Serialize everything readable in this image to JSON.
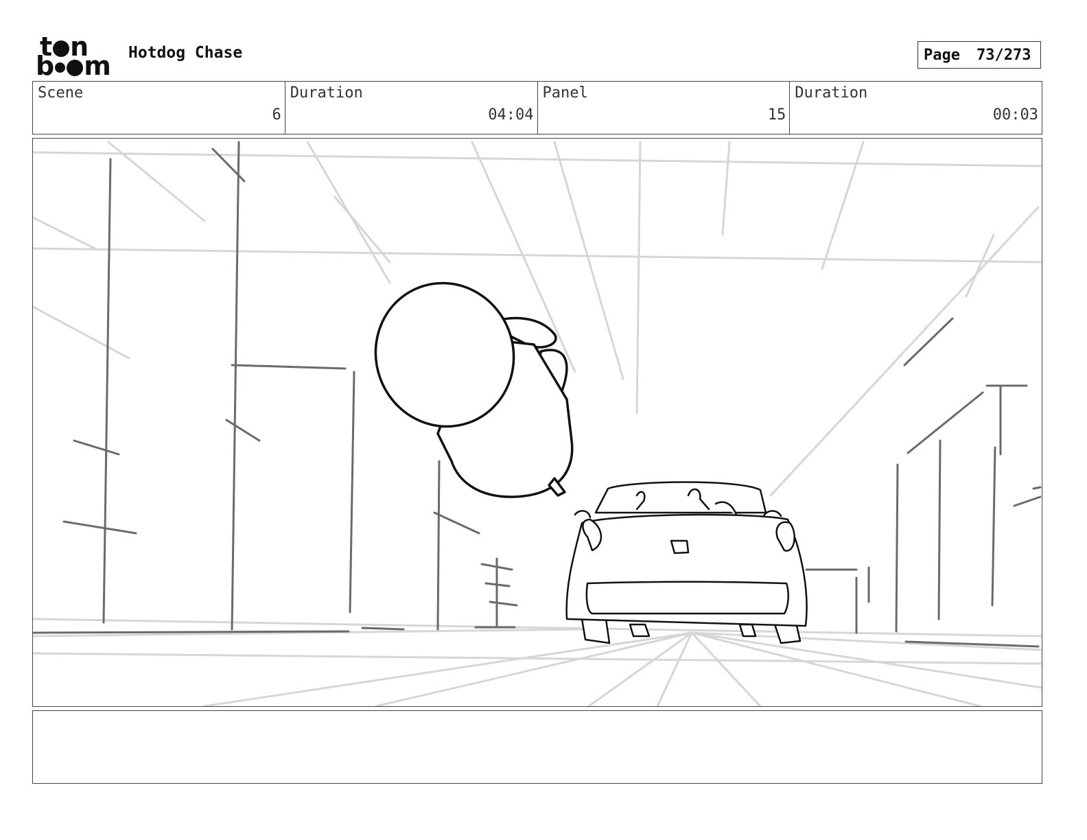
{
  "header": {
    "logo": {
      "line1": "t n",
      "line2": "b m",
      "alt": "toon boom"
    },
    "project_title": "Hotdog Chase",
    "page_label": "Page",
    "page_value": "73/273"
  },
  "info": {
    "scene_label": "Scene",
    "scene_value": "6",
    "scene_duration_label": "Duration",
    "scene_duration_value": "04:04",
    "panel_label": "Panel",
    "panel_value": "15",
    "panel_duration_label": "Duration",
    "panel_duration_value": "00:03"
  },
  "panel_image": {
    "description_icon": "storyboard-sketch",
    "line_color_dark": "#111111",
    "line_color_mid": "#666666",
    "line_color_light": "#d0d0d0"
  },
  "notes": {
    "text": ""
  }
}
